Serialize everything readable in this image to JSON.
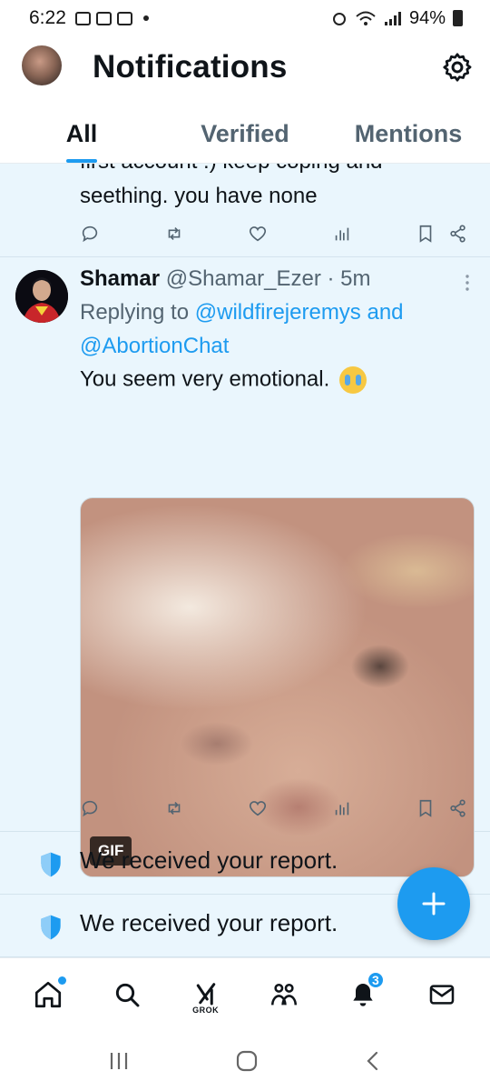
{
  "status_bar": {
    "time": "6:22",
    "battery": "94%"
  },
  "header": {
    "title": "Notifications"
  },
  "tabs": [
    {
      "label": "All",
      "active": true
    },
    {
      "label": "Verified",
      "active": false
    },
    {
      "label": "Mentions",
      "active": false
    }
  ],
  "partial_post": {
    "text_line1": "first account :) keep coping and",
    "text_line2": "seething. you have none"
  },
  "post": {
    "author_name": "Shamar",
    "author_handle": "@Shamar_Ezer",
    "separator": " · ",
    "time": "5m",
    "replying_prefix": "Replying to ",
    "mention1": "@wildfirejeremys",
    "mention_joiner": " and",
    "mention2": "@AbortionChat",
    "text": "You seem very emotional.",
    "emoji": "loudly-crying-face",
    "media_badge": "GIF"
  },
  "notifications": [
    {
      "icon": "shield-icon",
      "text": "We received your report."
    },
    {
      "icon": "shield-icon",
      "text": "We received your report."
    }
  ],
  "bottom_nav": {
    "items": [
      "home-icon",
      "search-icon",
      "grok-icon",
      "communities-icon",
      "notifications-icon",
      "messages-icon"
    ],
    "grok_label": "GROK",
    "notification_count": "3"
  },
  "colors": {
    "accent": "#1d9bf0",
    "unread_background": "#eaf6fd",
    "secondary_text": "#536471"
  }
}
